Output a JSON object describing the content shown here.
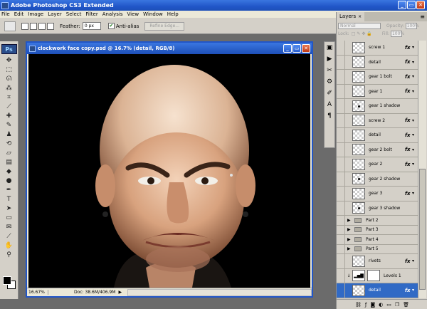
{
  "app": {
    "title": "Adobe Photoshop CS3 Extended",
    "logo": "Ps"
  },
  "menu": [
    "File",
    "Edit",
    "Image",
    "Layer",
    "Select",
    "Filter",
    "Analysis",
    "View",
    "Window",
    "Help"
  ],
  "options": {
    "feather_label": "Feather:",
    "feather_value": "0 px",
    "antialias_label": "Anti-alias",
    "refine_label": "Refine Edge..."
  },
  "document": {
    "title": "clockwork face copy.psd @ 16.7% (detail, RGB/8)",
    "zoom": "16.67%",
    "doc_size": "Doc: 38.6M/406.9M"
  },
  "layers_panel": {
    "tab": "Layers",
    "blend_mode": "Normal",
    "opacity_label": "Opacity:",
    "opacity_value": "100%",
    "lock_label": "Lock:",
    "fill_label": "Fill:",
    "fill_value": "100%",
    "layers": [
      {
        "name": "screw 1",
        "kind": "layer",
        "fx": true
      },
      {
        "name": "detail",
        "kind": "layer",
        "fx": true
      },
      {
        "name": "gear 1 bolt",
        "kind": "layer",
        "fx": true
      },
      {
        "name": "gear 1",
        "kind": "layer",
        "fx": true
      },
      {
        "name": "gear 1 shadow",
        "kind": "layer",
        "fx": false
      },
      {
        "name": "screw 2",
        "kind": "layer",
        "fx": true
      },
      {
        "name": "detail",
        "kind": "layer",
        "fx": true
      },
      {
        "name": "gear 2 bolt",
        "kind": "layer",
        "fx": true
      },
      {
        "name": "gear 2",
        "kind": "layer",
        "fx": true
      },
      {
        "name": "gear 2 shadow",
        "kind": "layer",
        "fx": false
      },
      {
        "name": "gear 3",
        "kind": "layer",
        "fx": true
      },
      {
        "name": "gear 3 shadow",
        "kind": "layer",
        "fx": false
      },
      {
        "name": "Part 2",
        "kind": "group"
      },
      {
        "name": "Part 3",
        "kind": "group"
      },
      {
        "name": "Part 4",
        "kind": "group"
      },
      {
        "name": "Part 5",
        "kind": "group"
      },
      {
        "name": "rivets",
        "kind": "layer",
        "fx": true
      },
      {
        "name": "Levels 1",
        "kind": "adjustment"
      },
      {
        "name": "detail",
        "kind": "layer",
        "fx": true,
        "selected": true
      }
    ],
    "fx_label": "fx"
  },
  "colors": {
    "titlebar": "#2156c8",
    "chrome": "#d4d0c8",
    "selected_layer": "#316ac5",
    "canvas_bg": "#000000"
  }
}
